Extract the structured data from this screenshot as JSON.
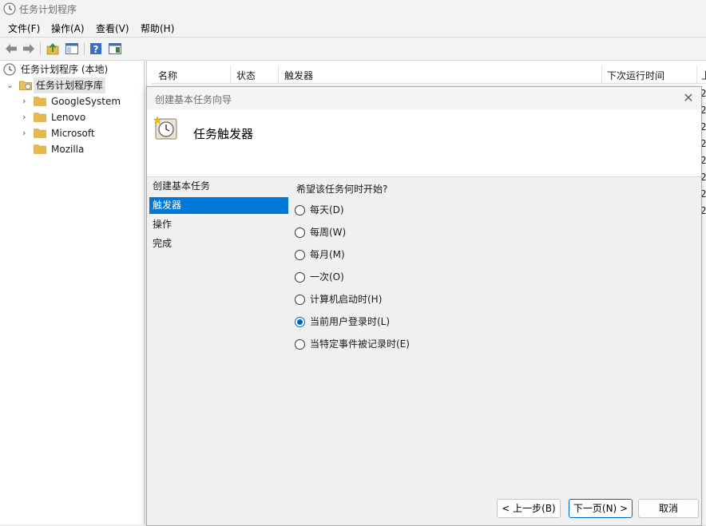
{
  "window": {
    "title": "任务计划程序"
  },
  "menu": [
    "文件(F)",
    "操作(A)",
    "查看(V)",
    "帮助(H)"
  ],
  "toolbar": {
    "icons": [
      "back-arrow-icon",
      "forward-arrow-icon",
      "up-folder-icon",
      "show-hide-console-tree-icon",
      "help-icon",
      "show-hide-action-pane-icon"
    ]
  },
  "tree": {
    "root": "任务计划程序 (本地)",
    "library": "任务计划程序库",
    "folders": [
      "GoogleSystem",
      "Lenovo",
      "Microsoft",
      "Mozilla"
    ]
  },
  "list": {
    "columns": [
      "名称",
      "状态",
      "触发器",
      "下次运行时间",
      "上"
    ],
    "partial_values": [
      "2",
      "2",
      "2",
      "2",
      "2",
      "2",
      "2",
      "2"
    ]
  },
  "dialog": {
    "title": "创建基本任务向导",
    "header_title": "任务触发器",
    "steps": [
      "创建基本任务",
      "触发器",
      "操作",
      "完成"
    ],
    "active_step": "触发器",
    "question": "希望该任务何时开始?",
    "options": [
      {
        "label": "每天(D)",
        "checked": false
      },
      {
        "label": "每周(W)",
        "checked": false
      },
      {
        "label": "每月(M)",
        "checked": false
      },
      {
        "label": "一次(O)",
        "checked": false
      },
      {
        "label": "计算机启动时(H)",
        "checked": false
      },
      {
        "label": "当前用户登录时(L)",
        "checked": true
      },
      {
        "label": "当特定事件被记录时(E)",
        "checked": false
      }
    ],
    "buttons": {
      "back": "< 上一步(B)",
      "next": "下一页(N) >",
      "cancel": "取消"
    }
  },
  "colors": {
    "accent": "#0078d7",
    "radio_selected": "#0067c0",
    "folder": "#e8b84a"
  }
}
